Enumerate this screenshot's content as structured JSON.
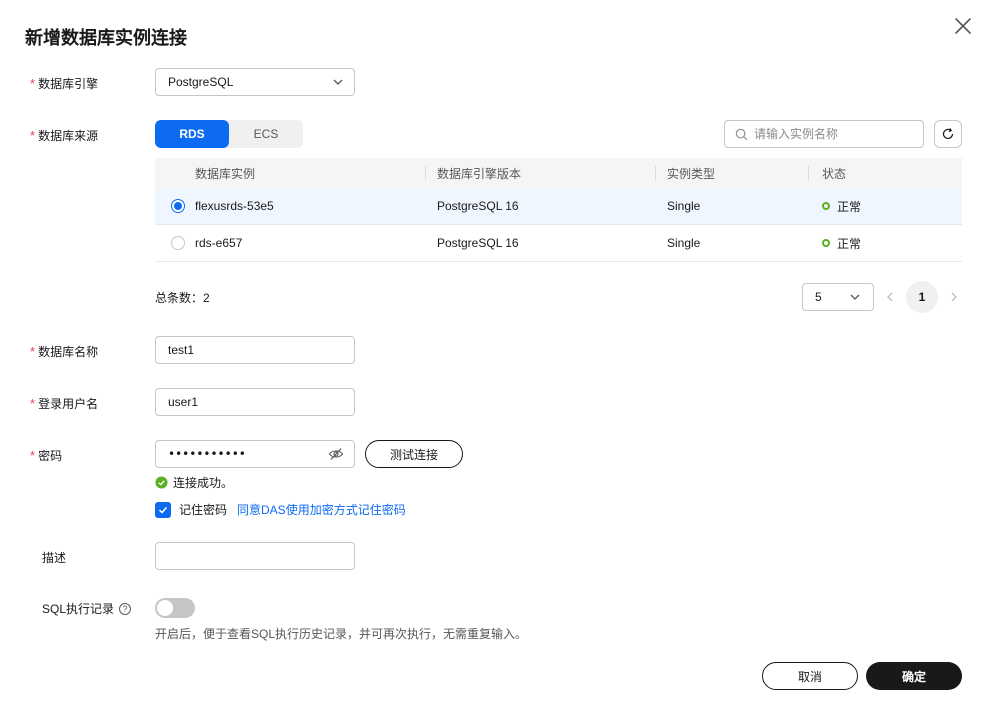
{
  "dialog": {
    "title": "新增数据库实例连接"
  },
  "engine": {
    "label": "数据库引擎",
    "value": "PostgreSQL"
  },
  "source": {
    "label": "数据库来源",
    "tabs": [
      {
        "label": "RDS",
        "active": true
      },
      {
        "label": "ECS",
        "active": false
      }
    ],
    "search_placeholder": "请输入实例名称"
  },
  "table": {
    "headers": [
      "数据库实例",
      "数据库引擎版本",
      "实例类型",
      "状态"
    ],
    "rows": [
      {
        "name": "flexusrds-53e5",
        "version": "PostgreSQL 16",
        "type": "Single",
        "status": "正常",
        "selected": true
      },
      {
        "name": "rds-e657",
        "version": "PostgreSQL 16",
        "type": "Single",
        "status": "正常",
        "selected": false
      }
    ],
    "total": "总条数：2",
    "page_size": "5",
    "current_page": "1"
  },
  "db_name": {
    "label": "数据库名称",
    "value": "test1"
  },
  "username": {
    "label": "登录用户名",
    "value": "user1"
  },
  "password": {
    "label": "密码",
    "value": "•••••••••••",
    "test_button": "测试连接",
    "success_msg": "连接成功。"
  },
  "remember": {
    "label": "记住密码",
    "link": "同意DAS使用加密方式记住密码",
    "checked": true
  },
  "description": {
    "label": "描述",
    "value": ""
  },
  "sql_history": {
    "label": "SQL执行记录",
    "enabled": false,
    "hint": "开启后，便于查看SQL执行历史记录，并可再次执行，无需重复输入。"
  },
  "footer": {
    "cancel": "取消",
    "confirm": "确定"
  },
  "colors": {
    "primary": "#0d6bf2",
    "required": "#e7464f",
    "success": "#5cae22",
    "dark": "#191919"
  }
}
